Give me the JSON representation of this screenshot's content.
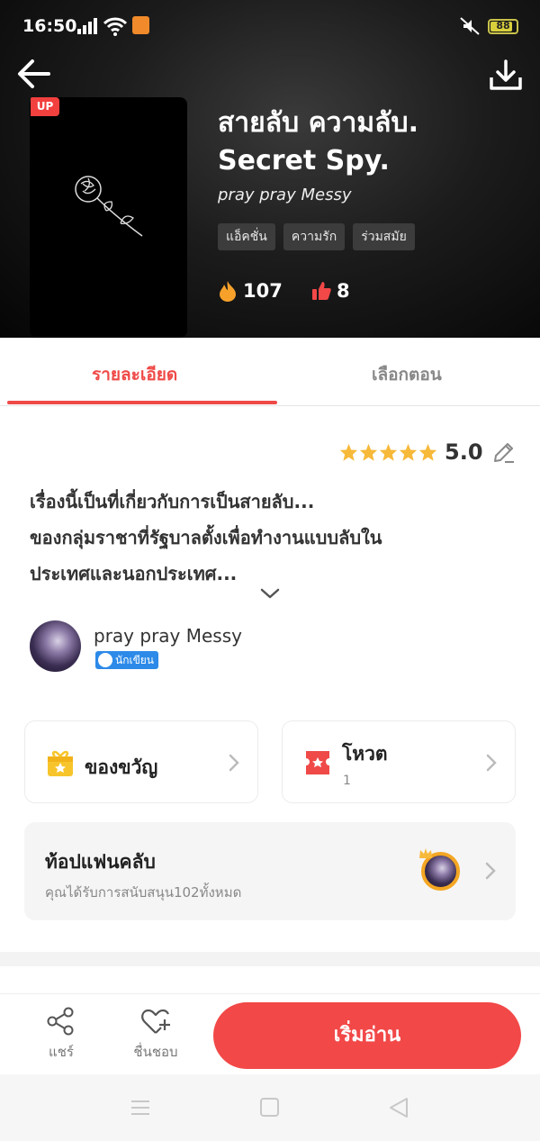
{
  "status_bar": {
    "time": "16:50",
    "battery": "88",
    "battery_level": 0.88
  },
  "book": {
    "badge": "UP",
    "title": "สายลับ ความลับ. Secret Spy.",
    "author": "pray pray Messy",
    "tags": [
      "แอ็คชั่น",
      "ความรัก",
      "ร่วมสมัย"
    ],
    "fire_count": "107",
    "like_count": "8"
  },
  "tabs": {
    "details": "รายละเอียด",
    "episodes": "เลือกตอน"
  },
  "details": {
    "rating": "5.0",
    "stars": 5,
    "synopsis_lines": [
      "เรื่องนี้เป็นที่เกี่ยวกับการเป็นสายลับ...",
      "ของกลุ่มราชาที่รัฐบาลตั้งเพื่อทำงานแบบลับใน",
      "ประเทศและนอกประเทศ..."
    ],
    "writer_name": "pray pray Messy",
    "writer_badge": "นักเขียน"
  },
  "cards": {
    "gift_label": "ของขวัญ",
    "vote_label": "โหวต",
    "vote_count": "1"
  },
  "fanclub": {
    "title": "ท้อปแฟนคลับ",
    "subtitle": "คุณได้รับการสนับสนุน102ทั้งหมด"
  },
  "actions": {
    "share": "แชร์",
    "favorite": "ชื่นชอบ",
    "read": "เริ่มอ่าน"
  },
  "colors": {
    "accent": "#f24848",
    "tab_active": "#ef4a48",
    "gift": "#f7c52b",
    "vote": "#ef4a48",
    "badge": "#2d8ae8"
  }
}
